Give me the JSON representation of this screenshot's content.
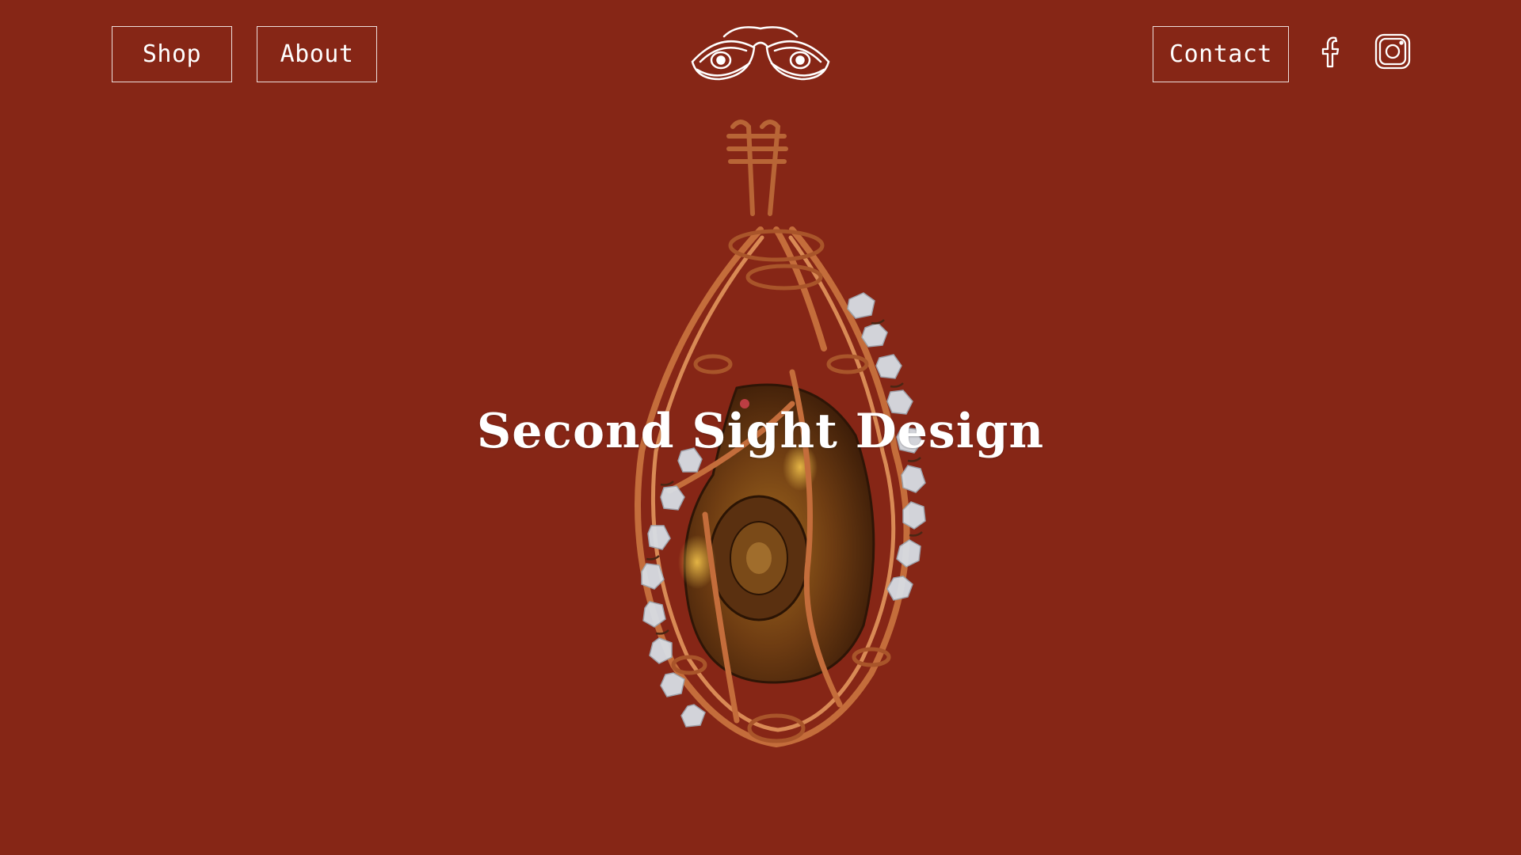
{
  "nav": {
    "shop_label": "Shop",
    "about_label": "About",
    "contact_label": "Contact"
  },
  "brand": {
    "logo_icon": "eyes-with-spectacles-logo"
  },
  "social": {
    "facebook_icon": "facebook-icon",
    "instagram_icon": "instagram-icon"
  },
  "hero": {
    "title": "Second Sight Design",
    "image_icon": "copper-wire-wrapped-ammonite-pendant"
  },
  "colors": {
    "background": "#862616",
    "text": "#ffffff",
    "copper": "#c9723e"
  }
}
